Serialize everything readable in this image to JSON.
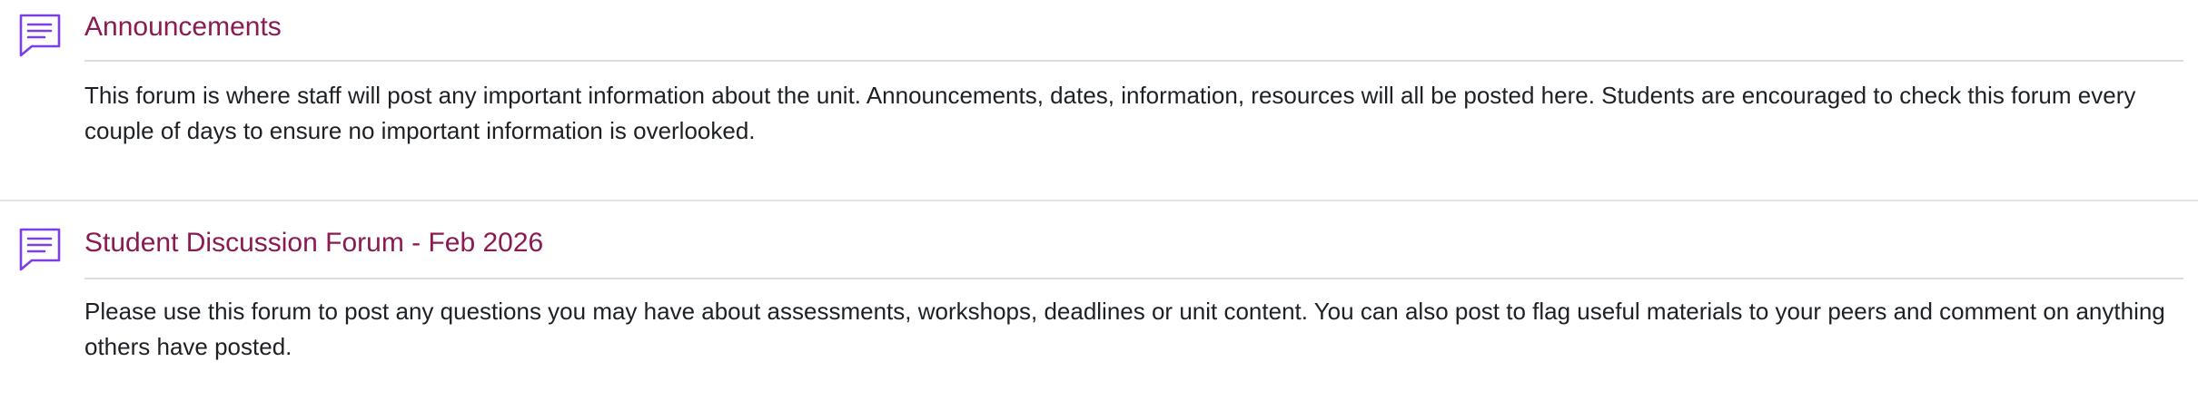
{
  "activities": [
    {
      "type_icon": "forum-icon",
      "title": "Announcements",
      "description": "This forum is where staff will post any important information about the unit. Announcements, dates, information, resources will all be posted here. Students are encouraged to check this forum every couple of days to ensure no important information is overlooked."
    },
    {
      "type_icon": "forum-icon",
      "title": "Student Discussion Forum - Feb 2026",
      "description": "Please use this forum to post any questions you may have about assessments, workshops, deadlines or unit content. You can also post to flag useful materials to your peers and comment on anything others have posted."
    }
  ],
  "colors": {
    "title": "#8b1a52",
    "icon": "#7b3fe4",
    "text": "#1d2125",
    "divider": "#dcdcdc"
  }
}
